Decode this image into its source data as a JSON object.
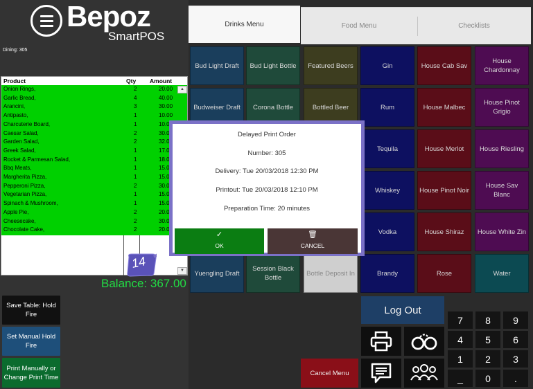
{
  "logo": {
    "brand": "Bepoz",
    "sub": "SmartPOS"
  },
  "dining_label": "Dining: 305",
  "order": {
    "headers": {
      "product": "Product",
      "qty": "Qty",
      "amount": "Amount"
    },
    "rows": [
      {
        "product": "Onion Rings,",
        "qty": "2",
        "amount": "20.00"
      },
      {
        "product": "Garlic Bread,",
        "qty": "4",
        "amount": "40.00"
      },
      {
        "product": "Arancini,",
        "qty": "3",
        "amount": "30.00"
      },
      {
        "product": "Antipasto,",
        "qty": "1",
        "amount": "10.00"
      },
      {
        "product": "Charcuterie Board,",
        "qty": "1",
        "amount": "10.0"
      },
      {
        "product": "Caesar Salad,",
        "qty": "2",
        "amount": "30.0"
      },
      {
        "product": "Garden Salad,",
        "qty": "2",
        "amount": "32.0"
      },
      {
        "product": "Greek Salad,",
        "qty": "1",
        "amount": "17.0"
      },
      {
        "product": "Rocket & Parmesan Salad,",
        "qty": "1",
        "amount": "18.0"
      },
      {
        "product": "Bbq Meats,",
        "qty": "1",
        "amount": "15.0"
      },
      {
        "product": "Margherita Pizza,",
        "qty": "1",
        "amount": "15.0"
      },
      {
        "product": "Pepperoni Pizza,",
        "qty": "2",
        "amount": "30.0"
      },
      {
        "product": "Vegetarian Pizza,",
        "qty": "1",
        "amount": "15.0"
      },
      {
        "product": "Spinach & Mushroom,",
        "qty": "1",
        "amount": "15.0"
      },
      {
        "product": "Apple Pie,",
        "qty": "2",
        "amount": "20.0"
      },
      {
        "product": "Cheesecake,",
        "qty": "2",
        "amount": "30.0"
      },
      {
        "product": "Chocolate Cake,",
        "qty": "2",
        "amount": "20.0"
      }
    ]
  },
  "balance": "Balance: 367.00",
  "side_buttons": {
    "save_table": "Save Table: Hold Fire",
    "set_manual": "Set Manual Hold Fire",
    "print_manually": "Print Manually or Change Print Time"
  },
  "tabs": {
    "drinks": "Drinks Menu",
    "food": "Food Menu",
    "checklists": "Checklists"
  },
  "grid": {
    "bud_light_draft": "Bud Light Draft",
    "bud_light_bottle": "Bud Light Bottle",
    "featured_beers": "Featured Beers",
    "gin": "Gin",
    "house_cab_sav": "House Cab Sav",
    "house_chardonnay": "House Chardonnay",
    "budweiser_draft": "Budweiser Draft",
    "corona_bottle": "Corona Bottle",
    "bottled_beer": "Bottled Beer",
    "rum": "Rum",
    "house_malbec": "House Malbec",
    "house_pinot_grigio": "House Pinot Grigio",
    "tequila": "Tequila",
    "house_merlot": "House Merlot",
    "house_riesling": "House Riesling",
    "whiskey": "Whiskey",
    "house_pinot_noir": "House Pinot Noir",
    "house_sav_blanc": "House Sav Blanc",
    "vodka": "Vodka",
    "house_shiraz": "House Shiraz",
    "house_white_zin": "House White Zin",
    "yuengling_draft": "Yuengling Draft",
    "session_black_bottle": "Session Black Bottle",
    "bottle_deposit_in": "Bottle Deposit In",
    "brandy": "Brandy",
    "rose": "Rose",
    "water": "Water"
  },
  "logout": "Log Out",
  "cancel_menu": "Cancel Menu",
  "keypad": [
    "7",
    "8",
    "9",
    "4",
    "5",
    "6",
    "1",
    "2",
    "3",
    "_",
    "0",
    "."
  ],
  "dialog": {
    "title": "Delayed Print Order",
    "number": "Number: 305",
    "delivery": "Delivery: Tue 20/03/2018 12:30 PM",
    "printout": "Printout: Tue 20/03/2018 12:10 PM",
    "prep": "Preparation Time: 20 minutes",
    "ok": "OK",
    "cancel": "CANCEL"
  },
  "step_badge": "14",
  "colors": {
    "order_green": "#00d000",
    "balance_green": "#22dd44",
    "dialog_border": "#7b71c7",
    "ok_green": "#0b7d12",
    "cancel_brown": "#4a3636",
    "logout_blue": "#1e3f66"
  }
}
